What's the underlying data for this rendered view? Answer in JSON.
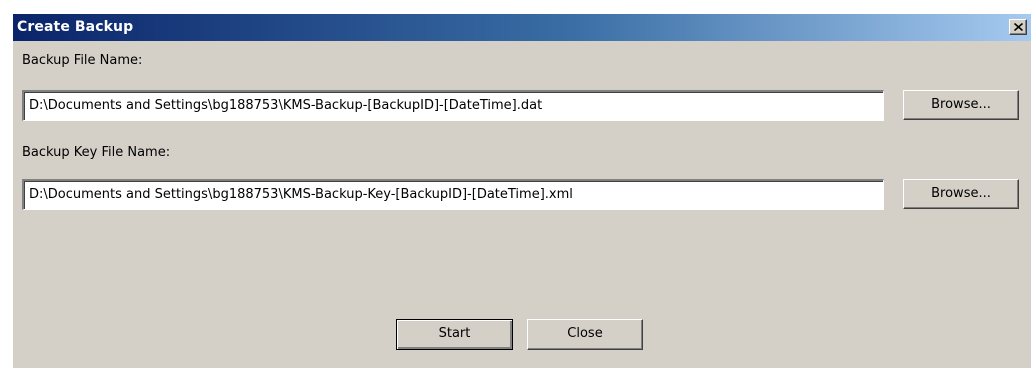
{
  "window": {
    "title": "Create Backup",
    "close_icon": "close-x-icon"
  },
  "backup_file": {
    "label": "Backup File Name:",
    "value": "D:\\Documents and Settings\\bg188753\\KMS-Backup-[BackupID]-[DateTime].dat",
    "browse_label": "Browse..."
  },
  "backup_key_file": {
    "label": "Backup Key File Name:",
    "value": "D:\\Documents and Settings\\bg188753\\KMS-Backup-Key-[BackupID]-[DateTime].xml",
    "browse_label": "Browse..."
  },
  "actions": {
    "start_label": "Start",
    "close_label": "Close"
  },
  "colors": {
    "title_bar_start": "#0a246a",
    "title_bar_end": "#a6caf0",
    "dialog_background": "#d4d0c8"
  }
}
